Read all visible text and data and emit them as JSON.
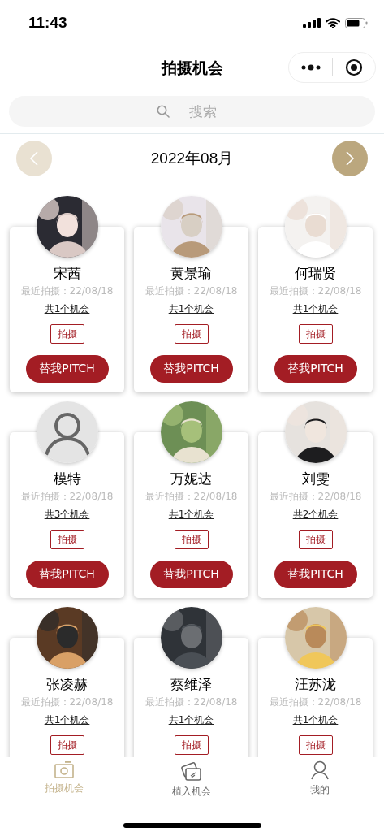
{
  "status_bar": {
    "time": "11:43"
  },
  "nav": {
    "title": "拍摄机会"
  },
  "search": {
    "placeholder": "搜索"
  },
  "month": {
    "label": "2022年08月",
    "prev_disabled": true,
    "next_disabled": false
  },
  "cards": [
    {
      "kind": "picture",
      "name": "宋茜",
      "last": "最近拍摄：22/08/18",
      "count": "共1个机会",
      "tag": "拍摄",
      "pitch": "替我PITCH"
    },
    {
      "kind": "picture",
      "name": "黄景瑜",
      "last": "最近拍摄：22/08/18",
      "count": "共1个机会",
      "tag": "拍摄",
      "pitch": "替我PITCH"
    },
    {
      "kind": "picture",
      "name": "何瑞贤",
      "last": "最近拍摄：22/08/18",
      "count": "共1个机会",
      "tag": "拍摄",
      "pitch": "替我PITCH"
    },
    {
      "kind": "default",
      "name": "模特",
      "last": "最近拍摄：22/08/18",
      "count": "共3个机会",
      "tag": "拍摄",
      "pitch": "替我PITCH"
    },
    {
      "kind": "picture",
      "name": "万妮达",
      "last": "最近拍摄：22/08/18",
      "count": "共1个机会",
      "tag": "拍摄",
      "pitch": "替我PITCH"
    },
    {
      "kind": "picture",
      "name": "刘雯",
      "last": "最近拍摄：22/08/18",
      "count": "共2个机会",
      "tag": "拍摄",
      "pitch": "替我PITCH"
    },
    {
      "kind": "picture",
      "name": "张凌赫",
      "last": "最近拍摄：22/08/18",
      "count": "共1个机会",
      "tag": "拍摄"
    },
    {
      "kind": "picture",
      "name": "蔡维泽",
      "last": "最近拍摄：22/08/18",
      "count": "共1个机会",
      "tag": "拍摄"
    },
    {
      "kind": "picture",
      "name": "汪苏泷",
      "last": "最近拍摄：22/08/18",
      "count": "共1个机会",
      "tag": "拍摄"
    }
  ],
  "tabs": [
    {
      "label": "拍摄机会",
      "selected": true
    },
    {
      "label": "植入机会",
      "selected": false
    },
    {
      "label": "我的",
      "selected": false
    }
  ]
}
